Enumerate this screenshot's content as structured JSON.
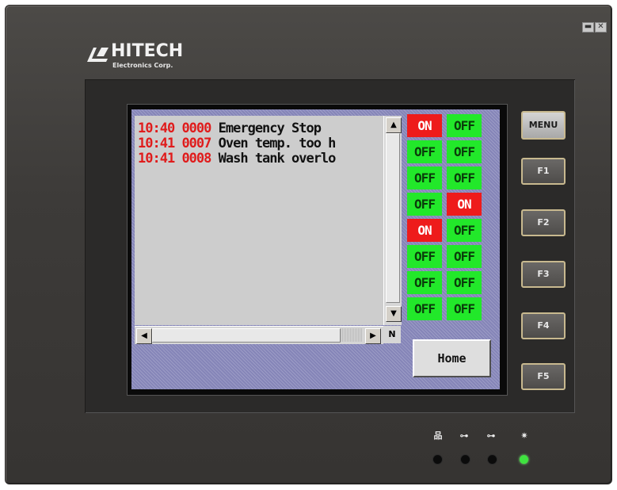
{
  "window_controls": [
    {
      "symbol": "▬"
    },
    {
      "symbol": "✕"
    }
  ],
  "brand": {
    "name": "HITECH",
    "subtitle": "Electronics Corp."
  },
  "alarms": [
    {
      "time": "10:40",
      "code": "0000",
      "message": "Emergency Stop"
    },
    {
      "time": "10:41",
      "code": "0007",
      "message": "Oven temp. too h"
    },
    {
      "time": "10:41",
      "code": "0008",
      "message": "Wash tank overlo"
    }
  ],
  "scrollbar": {
    "up": "▲",
    "down": "▼",
    "left": "◀",
    "right": "▶",
    "corner": "N"
  },
  "switches": [
    [
      "ON",
      "OFF"
    ],
    [
      "OFF",
      "OFF"
    ],
    [
      "OFF",
      "OFF"
    ],
    [
      "OFF",
      "ON"
    ],
    [
      "ON",
      "OFF"
    ],
    [
      "OFF",
      "OFF"
    ],
    [
      "OFF",
      "OFF"
    ],
    [
      "OFF",
      "OFF"
    ]
  ],
  "home_button": "Home",
  "function_keys": [
    "MENU",
    "F1",
    "F2",
    "F3",
    "F4",
    "F5"
  ],
  "status_indicators": [
    {
      "icon": "network-icon",
      "glyph": "品",
      "led": "off"
    },
    {
      "icon": "key-icon",
      "glyph": "⊶",
      "led": "off"
    },
    {
      "icon": "key-icon",
      "glyph": "⊶",
      "led": "off"
    },
    {
      "icon": "power-light-icon",
      "glyph": "✷",
      "led": "on"
    }
  ]
}
